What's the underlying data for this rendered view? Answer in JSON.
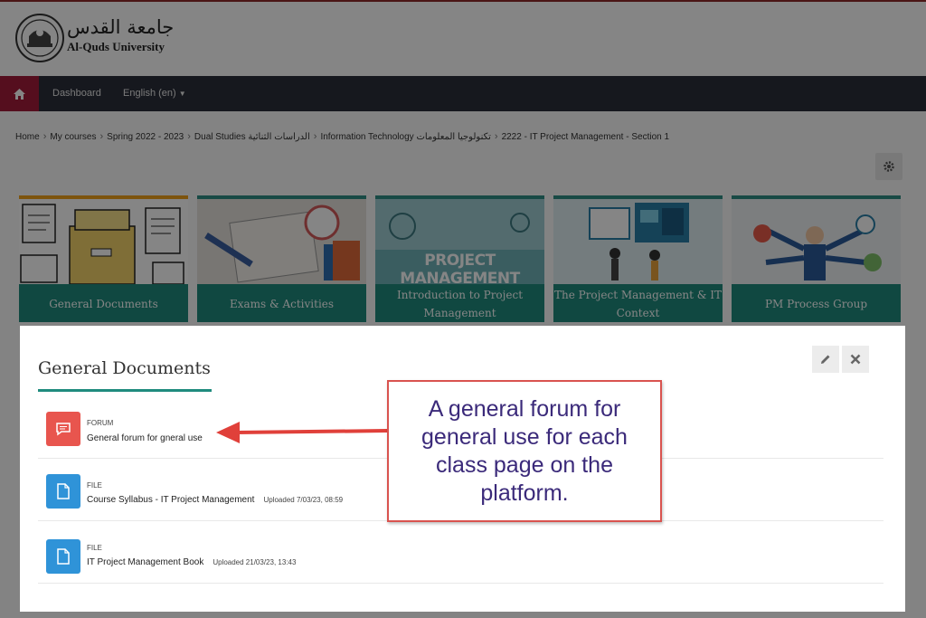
{
  "colors": {
    "brand": "#a31b3a",
    "navbar": "#2b2f3a",
    "teal": "#1f8b7e",
    "active_tab": "#f0a21a",
    "forum_icon": "#e8554e",
    "file_icon": "#2f93d8",
    "callout_border": "#d9534f",
    "callout_text": "#3b2a7a"
  },
  "logo": {
    "arabic": "جامعة القدس",
    "english": "Al-Quds University"
  },
  "navbar": {
    "dashboard": "Dashboard",
    "language": "English (en)"
  },
  "breadcrumb": [
    "Home",
    "My courses",
    "Spring 2022 - 2023",
    "Dual Studies الدراسات الثنائية",
    "Information Technology تكنولوجيا المعلومات",
    "2222 - IT Project Management - Section 1"
  ],
  "tiles": [
    {
      "label": "General Documents",
      "active": true
    },
    {
      "label": "Exams & Activities",
      "active": false
    },
    {
      "label": "Introduction to Project Management",
      "image_text": "PROJECT MANAGEMENT",
      "active": false
    },
    {
      "label": "The Project Management & IT Context",
      "active": false
    },
    {
      "label": "PM Process Group",
      "active": false
    }
  ],
  "modal": {
    "title": "General Documents",
    "activities": [
      {
        "type": "FORUM",
        "name": "General forum for gneral use",
        "meta": "",
        "icon": "forum-icon"
      },
      {
        "type": "FILE",
        "name": "Course Syllabus - IT Project Management",
        "meta": "Uploaded 7/03/23, 08:59",
        "icon": "file-icon"
      },
      {
        "type": "FILE",
        "name": "IT Project Management Book",
        "meta": "Uploaded 21/03/23, 13:43",
        "icon": "file-icon"
      }
    ]
  },
  "callout": {
    "text": "A general forum for general use for each class page on the platform."
  }
}
